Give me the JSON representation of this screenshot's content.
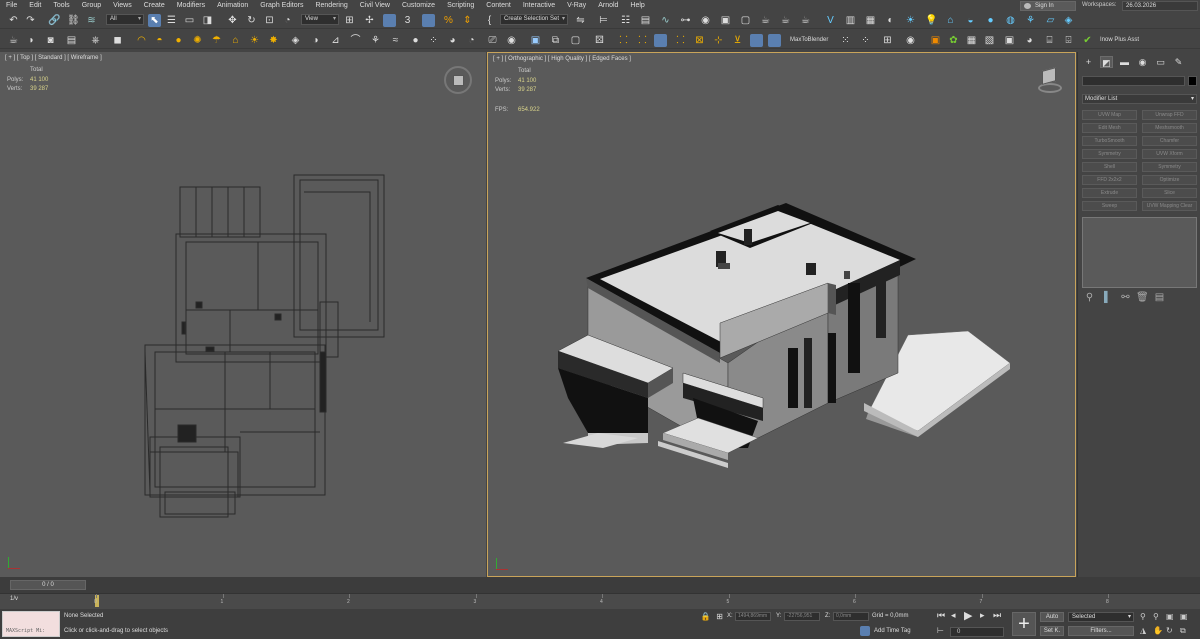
{
  "menu": [
    "File",
    "Edit",
    "Tools",
    "Group",
    "Views",
    "Create",
    "Modifiers",
    "Animation",
    "Graph Editors",
    "Rendering",
    "Civil View",
    "Customize",
    "Scripting",
    "Content",
    "Interactive",
    "V-Ray",
    "Arnold",
    "Help"
  ],
  "header": {
    "sign_in": "Sign In",
    "workspaces_label": "Workspaces:",
    "workspace_value": "26.03.2026"
  },
  "toolbar": {
    "selection_filter": "All",
    "ref_coord": "View",
    "selection_set": "Create Selection Set",
    "max_to_blender": "MaxToBlender",
    "inow_plus": "Inow Plus Asst"
  },
  "viewport_left": {
    "label": "[ + ] [ Top ] [ Standard ] [ Wireframe ]",
    "stats_total": "Total",
    "polys_label": "Polys:",
    "polys_value": "41 100",
    "verts_label": "Verts:",
    "verts_value": "39 287"
  },
  "viewport_right": {
    "label": "[ + ] [ Orthographic ] [ High Quality ] [ Edged Faces ]",
    "stats_total": "Total",
    "polys_label": "Polys:",
    "polys_value": "41 100",
    "verts_label": "Verts:",
    "verts_value": "39 287",
    "fps_label": "FPS:",
    "fps_value": "654.922"
  },
  "command_panel": {
    "modifier_list": "Modifier List",
    "buttons": [
      "UVW Map",
      "Unwrap FFD",
      "Edit Mesh",
      "Meshsmooth",
      "TurboSmooth",
      "Chamfer",
      "Symmetry",
      "UVW Xform",
      "Shell",
      "Symmetry",
      "FFD 2x2x2",
      "Optimize",
      "Extrude",
      "Slice",
      "Sweep",
      "UVW Mapping Clear"
    ]
  },
  "timeline": {
    "frame_counter": "0 / 0",
    "ticks": [
      "0",
      "1",
      "2",
      "3",
      "4",
      "5",
      "6",
      "7",
      "8",
      "9"
    ],
    "trackbar_label": "1/v"
  },
  "status": {
    "maxscript": "MAXScript Mi:",
    "selection": "None Selected",
    "prompt": "Click or click-and-drag to select objects",
    "x_label": "X:",
    "x_value": "1494,869mm",
    "y_label": "Y:",
    "y_value": "-22756,951",
    "z_label": "Z:",
    "z_value": "0,0mm",
    "grid": "Grid = 0,0mm",
    "add_time_tag": "Add Time Tag",
    "current_frame": "0",
    "auto": "Auto",
    "set_k": "Set K.",
    "selected": "Selected",
    "filters": "Filters..."
  },
  "colors": {
    "accent_blue": "#5a7fb0",
    "active_viewport_border": "#c9a45a",
    "viewport_bg": "#5a5a5a",
    "ui_bg": "#444444"
  }
}
